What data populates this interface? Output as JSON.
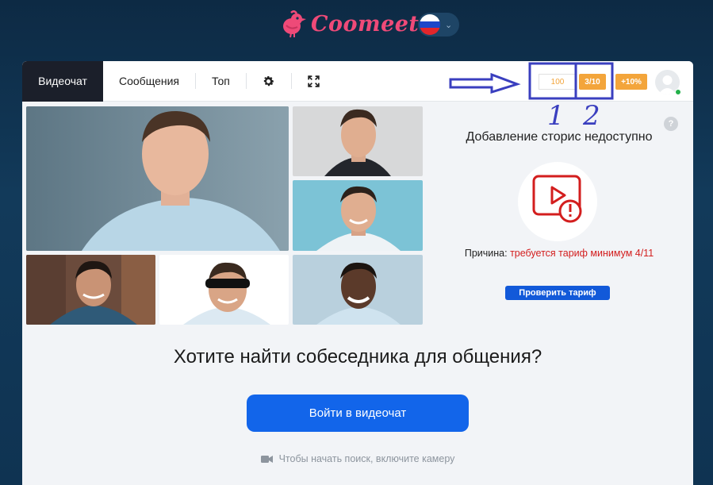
{
  "header": {
    "brand": "Coomeet",
    "language_flag": "russian-flag",
    "colors": {
      "brand": "#ee4a78",
      "bg": "#0f3352"
    }
  },
  "nav": {
    "tabs": [
      {
        "label": "Видеочат",
        "active": true
      },
      {
        "label": "Сообщения",
        "active": false
      },
      {
        "label": "Топ",
        "active": false
      }
    ],
    "settings_icon": "gear-icon",
    "fullscreen_icon": "fullscreen-icon"
  },
  "account": {
    "score": "100",
    "ratio": "3/10",
    "bonus": "+10%",
    "accent": "#f3a53b"
  },
  "annotations": {
    "label_1": "1",
    "label_2": "2"
  },
  "stories": {
    "title": "Добавление сторис недоступно",
    "help": "?",
    "reason_label": "Причина:",
    "reason_text": "требуется тариф минимум 4/11",
    "check_button": "Проверить тариф"
  },
  "cta": {
    "title": "Хотите найти собеседника для общения?",
    "button": "Войти в видеочат",
    "hint": "Чтобы начать поиск, включите камеру"
  }
}
